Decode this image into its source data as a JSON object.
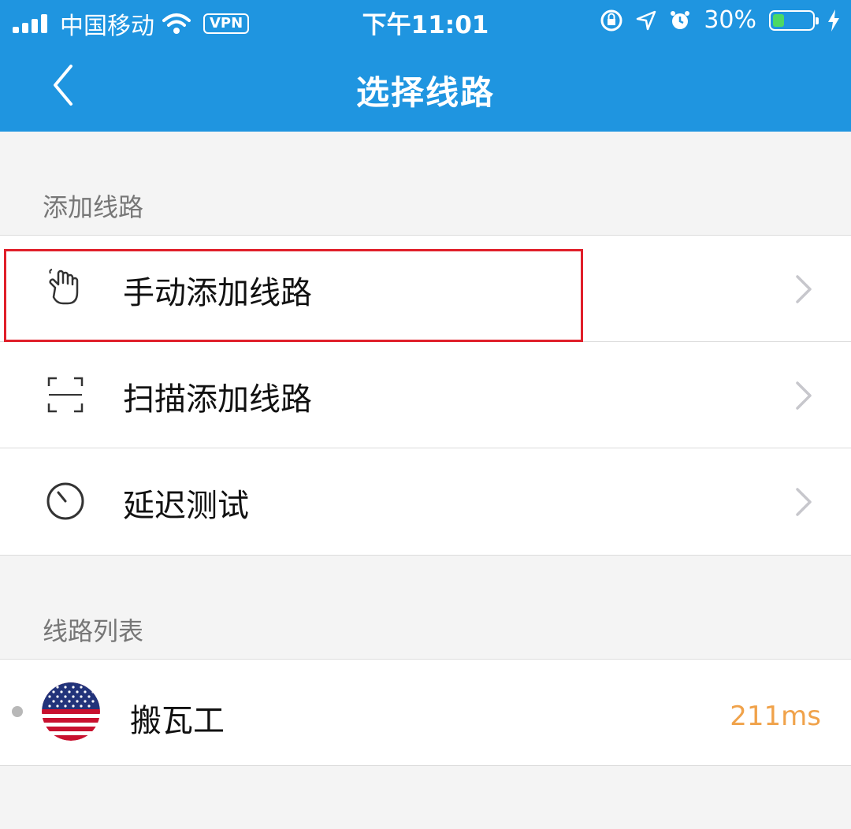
{
  "status_bar": {
    "carrier": "中国移动",
    "vpn": "VPN",
    "time": "下午11:01",
    "battery_percent": "30%",
    "battery_level": 0.3
  },
  "nav": {
    "title": "选择线路",
    "back_icon": "chevron-left-icon"
  },
  "sections": {
    "add": {
      "header": "添加线路",
      "items": [
        {
          "label": "手动添加线路",
          "icon": "hand-tap-icon"
        },
        {
          "label": "扫描添加线路",
          "icon": "scan-frame-icon"
        },
        {
          "label": "延迟测试",
          "icon": "timer-icon"
        }
      ]
    },
    "list": {
      "header": "线路列表",
      "servers": [
        {
          "name": "搬瓦工",
          "latency": "211ms",
          "flag": "us-flag-icon"
        }
      ]
    }
  },
  "colors": {
    "header_blue": "#1f95e0",
    "latency_orange": "#f0a24a",
    "highlight_red": "#e01f2a"
  }
}
